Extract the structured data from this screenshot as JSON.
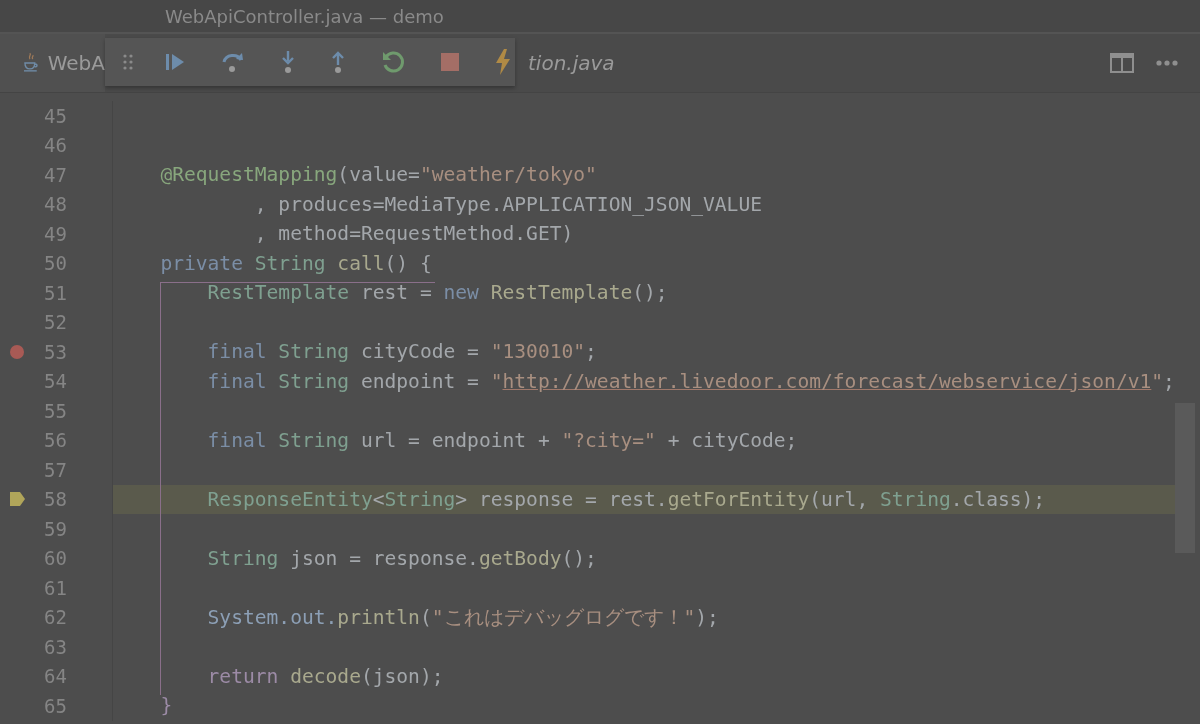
{
  "window": {
    "title": "WebApiController.java — demo"
  },
  "tabs": [
    {
      "label": "WebA",
      "selected": true,
      "italic": false
    },
    {
      "label": "tion.java",
      "selected": false,
      "italic": true
    }
  ],
  "debug_toolbar": {
    "buttons": [
      {
        "kind": "resume"
      },
      {
        "kind": "step-over"
      },
      {
        "kind": "step-into"
      },
      {
        "kind": "step-out"
      },
      {
        "kind": "rerun"
      },
      {
        "kind": "stop"
      },
      {
        "kind": "lightning"
      }
    ]
  },
  "editor": {
    "lines": [
      {
        "number": "45",
        "breakpoint": false,
        "current": false
      },
      {
        "number": "46",
        "breakpoint": false,
        "current": false
      },
      {
        "number": "47",
        "breakpoint": false,
        "current": false,
        "tokens": [
          {
            "kind": "ann",
            "text": "   @RequestMapping"
          },
          {
            "kind": "punct",
            "text": "("
          },
          {
            "kind": "plain",
            "text": "value="
          },
          {
            "kind": "str",
            "text": "\"weather/tokyo\""
          }
        ]
      },
      {
        "number": "48",
        "breakpoint": false,
        "current": false,
        "tokens": [
          {
            "kind": "plain",
            "text": "           , produces=MediaType.APPLICATION_JSON_VALUE"
          }
        ]
      },
      {
        "number": "49",
        "breakpoint": false,
        "current": false,
        "tokens": [
          {
            "kind": "plain",
            "text": "           , method=RequestMethod.GET"
          },
          {
            "kind": "punct",
            "text": ")"
          }
        ]
      },
      {
        "number": "50",
        "breakpoint": false,
        "current": false,
        "tokens": [
          {
            "kind": "kw",
            "text": "   private "
          },
          {
            "kind": "type",
            "text": "String "
          },
          {
            "kind": "fn",
            "text": "call"
          },
          {
            "kind": "punct",
            "text": "() {"
          }
        ]
      },
      {
        "number": "51",
        "breakpoint": false,
        "current": false,
        "tokens": [
          {
            "kind": "type",
            "text": "       RestTemplate"
          },
          {
            "kind": "plain",
            "text": " rest = "
          },
          {
            "kind": "kw",
            "text": "new "
          },
          {
            "kind": "fn",
            "text": "RestTemplate"
          },
          {
            "kind": "punct",
            "text": "();"
          }
        ]
      },
      {
        "number": "52",
        "breakpoint": false,
        "current": false
      },
      {
        "number": "53",
        "breakpoint": true,
        "current": false,
        "tokens": [
          {
            "kind": "kw",
            "text": "       final "
          },
          {
            "kind": "type",
            "text": "String"
          },
          {
            "kind": "plain",
            "text": " cityCode = "
          },
          {
            "kind": "str",
            "text": "\"130010\""
          },
          {
            "kind": "plain",
            "text": ";"
          }
        ]
      },
      {
        "number": "54",
        "breakpoint": false,
        "current": false,
        "tokens": [
          {
            "kind": "kw",
            "text": "       final "
          },
          {
            "kind": "type",
            "text": "String"
          },
          {
            "kind": "plain",
            "text": " endpoint = "
          },
          {
            "kind": "str",
            "text": "\""
          },
          {
            "kind": "url",
            "text": "http://weather.livedoor.com/forecast/webservice/json/v1"
          },
          {
            "kind": "str",
            "text": "\""
          },
          {
            "kind": "plain",
            "text": ";"
          }
        ]
      },
      {
        "number": "55",
        "breakpoint": false,
        "current": false
      },
      {
        "number": "56",
        "breakpoint": false,
        "current": false,
        "tokens": [
          {
            "kind": "kw",
            "text": "       final "
          },
          {
            "kind": "type",
            "text": "String"
          },
          {
            "kind": "plain",
            "text": " url = endpoint + "
          },
          {
            "kind": "str",
            "text": "\"?city=\""
          },
          {
            "kind": "plain",
            "text": " + cityCode;"
          }
        ]
      },
      {
        "number": "57",
        "breakpoint": false,
        "current": false
      },
      {
        "number": "58",
        "breakpoint": false,
        "current": true,
        "tokens": [
          {
            "kind": "type",
            "text": "       ResponseEntity"
          },
          {
            "kind": "punct",
            "text": "<"
          },
          {
            "kind": "type",
            "text": "String"
          },
          {
            "kind": "punct",
            "text": ">"
          },
          {
            "kind": "plain",
            "text": " response = rest."
          },
          {
            "kind": "fn",
            "text": "getForEntity"
          },
          {
            "kind": "punct",
            "text": "("
          },
          {
            "kind": "plain",
            "text": "url, "
          },
          {
            "kind": "type",
            "text": "String"
          },
          {
            "kind": "plain",
            "text": ".class"
          },
          {
            "kind": "punct",
            "text": ")"
          },
          {
            "kind": "plain",
            "text": ";"
          }
        ]
      },
      {
        "number": "59",
        "breakpoint": false,
        "current": false
      },
      {
        "number": "60",
        "breakpoint": false,
        "current": false,
        "tokens": [
          {
            "kind": "type",
            "text": "       String"
          },
          {
            "kind": "plain",
            "text": " json = response."
          },
          {
            "kind": "fn",
            "text": "getBody"
          },
          {
            "kind": "punct",
            "text": "()"
          },
          {
            "kind": "plain",
            "text": ";"
          }
        ]
      },
      {
        "number": "61",
        "breakpoint": false,
        "current": false
      },
      {
        "number": "62",
        "breakpoint": false,
        "current": false,
        "tokens": [
          {
            "kind": "field",
            "text": "       System.out."
          },
          {
            "kind": "fn",
            "text": "println"
          },
          {
            "kind": "punct",
            "text": "("
          },
          {
            "kind": "str",
            "text": "\"これはデバッグログです！\""
          },
          {
            "kind": "punct",
            "text": ")"
          },
          {
            "kind": "plain",
            "text": ";"
          }
        ]
      },
      {
        "number": "63",
        "breakpoint": false,
        "current": false
      },
      {
        "number": "64",
        "breakpoint": false,
        "current": false,
        "tokens": [
          {
            "kind": "ret",
            "text": "       return "
          },
          {
            "kind": "fn",
            "text": "decode"
          },
          {
            "kind": "punct",
            "text": "("
          },
          {
            "kind": "plain",
            "text": "json"
          },
          {
            "kind": "punct",
            "text": ")"
          },
          {
            "kind": "plain",
            "text": ";"
          }
        ]
      },
      {
        "number": "65",
        "breakpoint": false,
        "current": false,
        "tokens": [
          {
            "kind": "ret",
            "text": "   }"
          }
        ]
      }
    ]
  }
}
